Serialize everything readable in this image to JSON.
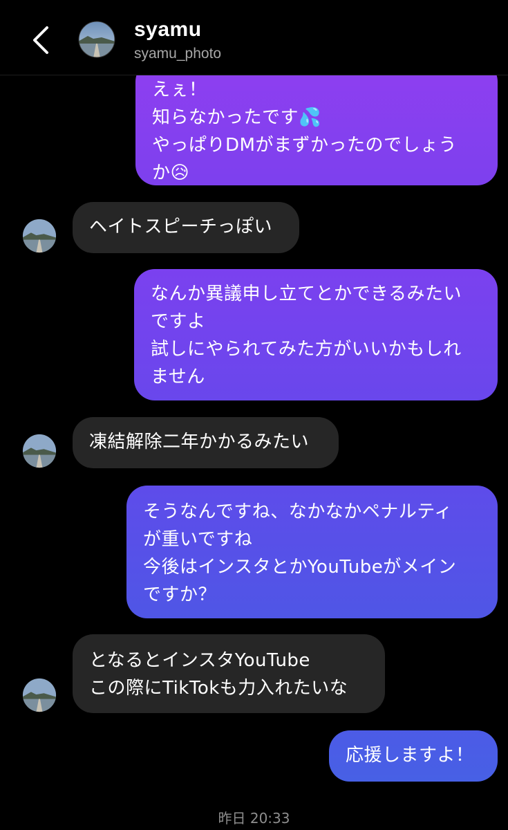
{
  "header": {
    "name": "syamu",
    "handle": "syamu_photo"
  },
  "messages": [
    {
      "dir": "out",
      "text": "えぇ！\n知らなかったです💦\nやっぱりDMがまずかったのでしょう\nか😥"
    },
    {
      "dir": "in",
      "text": "ヘイトスピーチっぽい"
    },
    {
      "dir": "out",
      "text": "なんか異議申し立てとかできるみたい\nですよ\n試しにやられてみた方がいいかもしれ\nません"
    },
    {
      "dir": "in",
      "text": "凍結解除二年かかるみたい"
    },
    {
      "dir": "out",
      "text": "そうなんですね、なかなかペナルティ\nが重いですね\n今後はインスタとかYouTubeがメイン\nですか？"
    },
    {
      "dir": "in",
      "text": "となるとインスタYouTube\nこの際にTikTokも力入れたいな"
    },
    {
      "dir": "out",
      "text": "応援しますよ！"
    }
  ],
  "timestamp": "昨日 20:33",
  "colors": {
    "background": "#000000",
    "incoming_bubble": "#262626",
    "outgoing_top": "#8a3cf0",
    "outgoing_bottom": "#4a5ee8"
  },
  "icons": {
    "back": "chevron-left-icon",
    "avatar": "avatar-photo"
  }
}
